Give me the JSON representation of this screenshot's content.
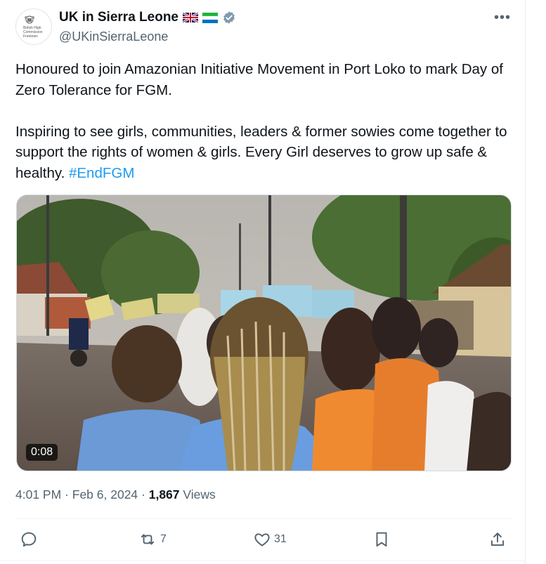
{
  "author": {
    "name": "UK in Sierra Leone",
    "handle": "@UKinSierraLeone",
    "avatar_text": "British High Commission Freetown",
    "verified_color": "#829aab"
  },
  "tweet": {
    "line1": "Honoured to join Amazonian Initiative Movement in Port Loko to mark Day of Zero Tolerance for FGM.",
    "line2": "Inspiring to see girls, communities, leaders & former sowies come together to support the rights of women & girls. Every Girl deserves to grow up safe & healthy. ",
    "hashtag": "#EndFGM"
  },
  "media": {
    "type": "video",
    "duration": "0:08"
  },
  "meta": {
    "time": "4:01 PM",
    "sep1": " · ",
    "date": "Feb 6, 2024",
    "sep2": " · ",
    "views_count": "1,867",
    "views_label": " Views"
  },
  "actions": {
    "retweets": "7",
    "likes": "31"
  },
  "colors": {
    "accent": "#1d9bf0",
    "muted": "#536471"
  }
}
